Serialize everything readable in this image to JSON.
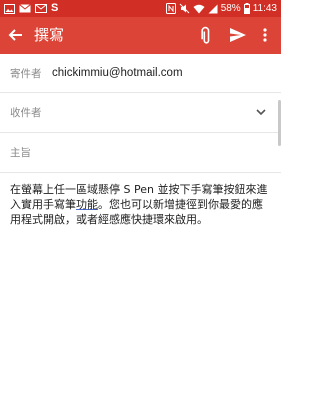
{
  "status_bar": {
    "left_glyph": "S",
    "battery": "58%",
    "time": "11:43",
    "icons": [
      "image-icon",
      "email-icon",
      "mail-icon",
      "s-logo-icon",
      "nfc-icon",
      "mute-icon",
      "wifi-icon",
      "signal-icon",
      "battery-icon"
    ]
  },
  "app_bar": {
    "title": "撰寫",
    "icons": [
      "back-arrow-icon",
      "paperclip-icon",
      "send-icon",
      "more-vert-icon"
    ],
    "color": "#db4437"
  },
  "compose": {
    "from_label": "寄件者",
    "from_value": "chickimmiu@hotmail.com",
    "to_label": "收件者",
    "subject_label": "主旨",
    "body_part1": "在螢幕上任一區域懸停 S Pen 並按下手寫筆按鈕來進入實用手寫筆",
    "body_underlined": "功能",
    "body_part2": "。您也可以新增捷徑到你最愛的應用程式開啟，或者經感應快捷環來啟用。"
  },
  "colors": {
    "status_bar": "#d12f25",
    "app_bar": "#db4437",
    "label": "#8a8a8a",
    "text": "#212121"
  }
}
